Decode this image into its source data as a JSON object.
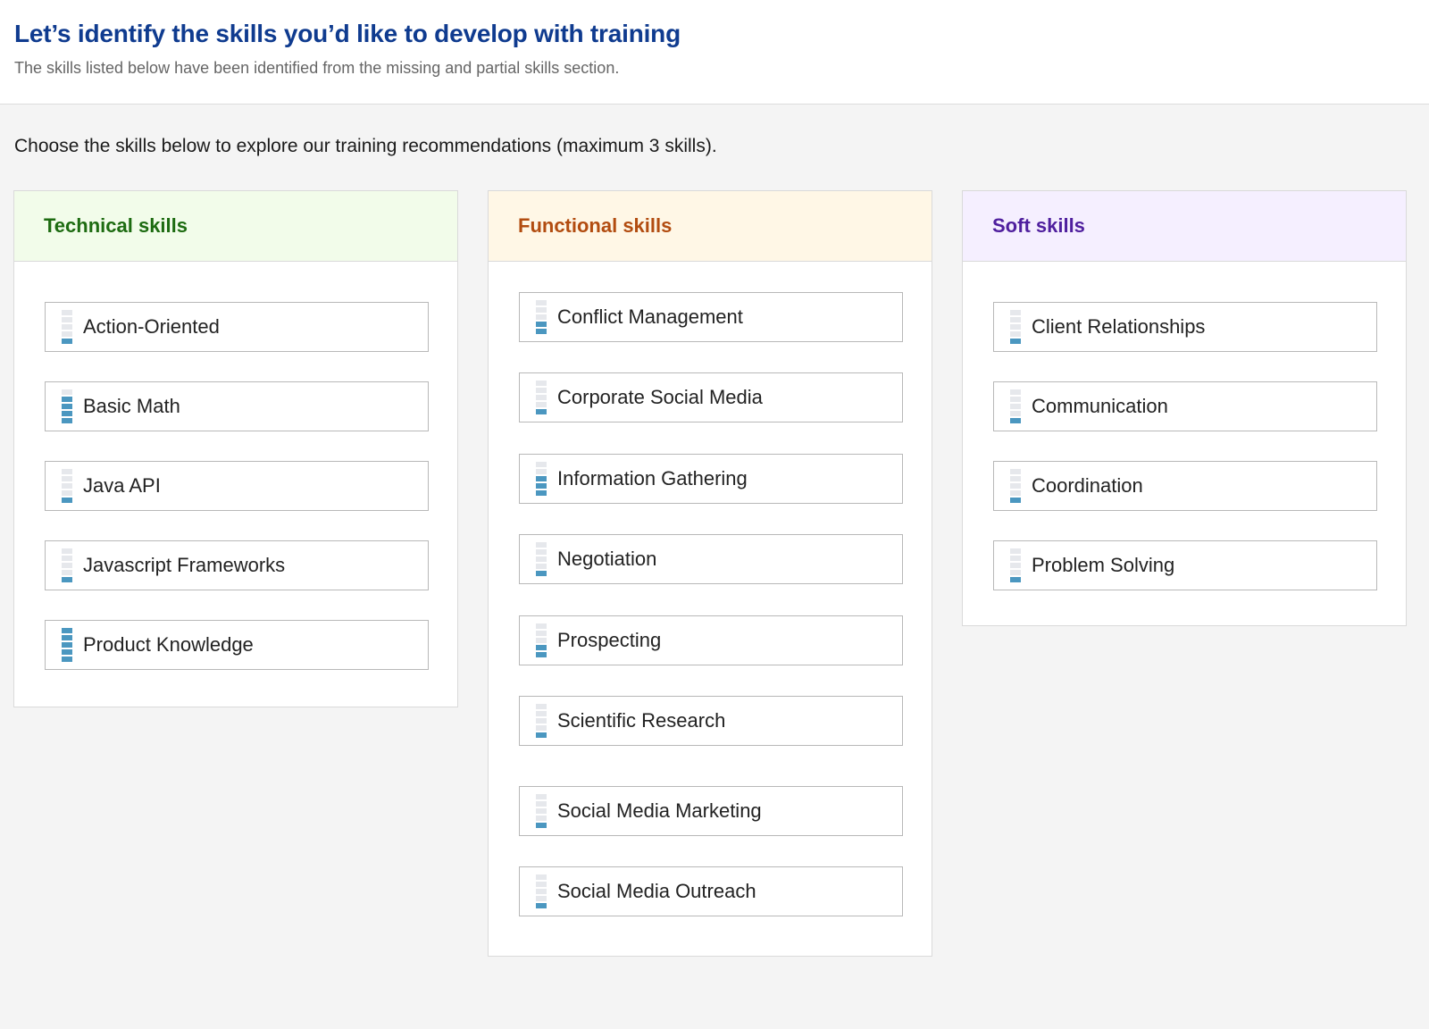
{
  "header": {
    "title": "Let’s identify the skills you’d like to develop with training",
    "subtitle": "The skills listed below have been identified from the missing and partial skills section."
  },
  "instructions": "Choose the skills below to explore our training recommendations (maximum 3 skills).",
  "colors": {
    "title": "#0f3b8f",
    "technical": "#1d6b11",
    "functional": "#b24c10",
    "soft": "#4f1f9e",
    "meter_filled": "#4b97c0",
    "meter_empty": "#e6e8ec"
  },
  "columns": [
    {
      "title": "Technical skills",
      "skills": [
        {
          "label": "Action-Oriented",
          "level": 1,
          "max": 5
        },
        {
          "label": "Basic Math",
          "level": 4,
          "max": 5
        },
        {
          "label": "Java API",
          "level": 1,
          "max": 5
        },
        {
          "label": "Javascript Frameworks",
          "level": 1,
          "max": 5
        },
        {
          "label": "Product Knowledge",
          "level": 5,
          "max": 5
        }
      ]
    },
    {
      "title": "Functional skills",
      "skills": [
        {
          "label": "Conflict Management",
          "level": 2,
          "max": 5
        },
        {
          "label": "Corporate Social Media",
          "level": 1,
          "max": 5
        },
        {
          "label": "Information Gathering",
          "level": 3,
          "max": 5
        },
        {
          "label": "Negotiation",
          "level": 1,
          "max": 5
        },
        {
          "label": "Prospecting",
          "level": 2,
          "max": 5
        },
        {
          "label": "Scientific Research",
          "level": 1,
          "max": 5
        },
        {
          "label": "Social Media Marketing",
          "level": 1,
          "max": 5
        },
        {
          "label": "Social Media Outreach",
          "level": 1,
          "max": 5
        }
      ]
    },
    {
      "title": "Soft skills",
      "skills": [
        {
          "label": "Client Relationships",
          "level": 1,
          "max": 5
        },
        {
          "label": "Communication",
          "level": 1,
          "max": 5
        },
        {
          "label": "Coordination",
          "level": 1,
          "max": 5
        },
        {
          "label": "Problem Solving",
          "level": 1,
          "max": 5
        }
      ]
    }
  ]
}
